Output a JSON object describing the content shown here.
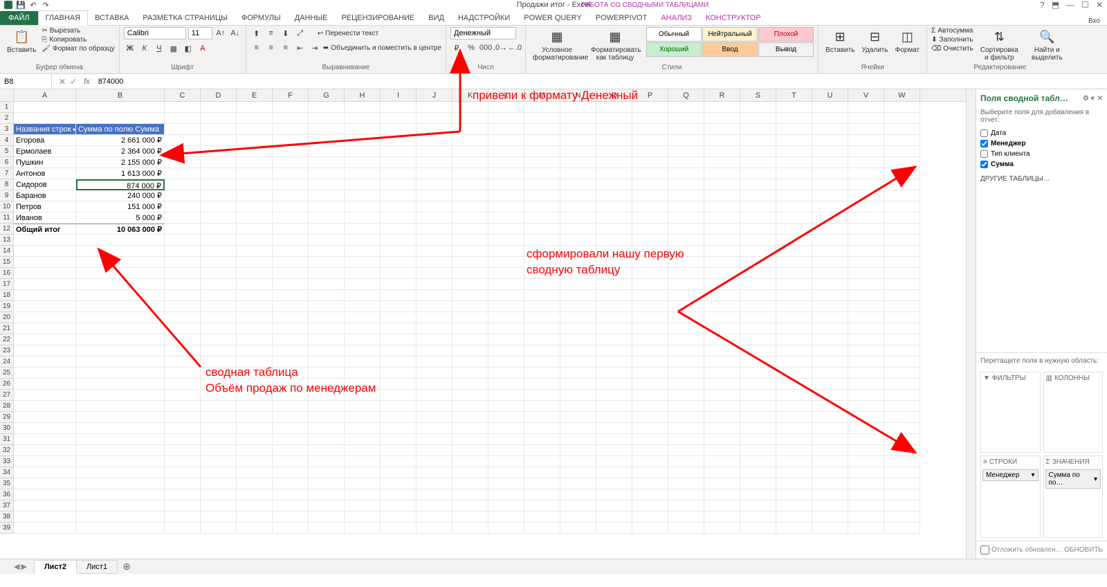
{
  "title": "Продажи итог - Excel",
  "context_title": "РАБОТА СО СВОДНЫМИ ТАБЛИЦАМИ",
  "login_hint": "Вхо",
  "tabs": {
    "file": "ФАЙЛ",
    "home": "ГЛАВНАЯ",
    "insert": "ВСТАВКА",
    "layout": "РАЗМЕТКА СТРАНИЦЫ",
    "formulas": "ФОРМУЛЫ",
    "data": "ДАННЫЕ",
    "review": "РЕЦЕНЗИРОВАНИЕ",
    "view": "ВИД",
    "addins": "НАДСТРОЙКИ",
    "powerquery": "POWER QUERY",
    "powerpivot": "POWERPIVOT",
    "analyze": "АНАЛИЗ",
    "design": "КОНСТРУКТОР"
  },
  "ribbon": {
    "clipboard": {
      "name": "Буфер обмена",
      "paste": "Вставить",
      "cut": "Вырезать",
      "copy": "Копировать",
      "format": "Формат по образцу"
    },
    "font": {
      "name": "Шрифт",
      "font_name": "Calibri",
      "font_size": "11"
    },
    "align": {
      "name": "Выравнивание",
      "wrap": "Перенести текст",
      "merge": "Объединить и поместить в центре"
    },
    "number": {
      "name": "Числ",
      "format": "Денежный"
    },
    "styles": {
      "name": "Стили",
      "cond": "Условное форматирование",
      "table": "Форматировать как таблицу",
      "s1": "Обычный",
      "s2": "Нейтральный",
      "s3": "Плохой",
      "s4": "Хороший",
      "s5": "Ввод",
      "s6": "Вывод"
    },
    "cells": {
      "name": "Ячейки",
      "insert": "Вставить",
      "delete": "Удалить",
      "format": "Формат"
    },
    "edit": {
      "name": "Редактирование",
      "sum": "Автосумма",
      "fill": "Заполнить",
      "clear": "Очистить",
      "sort": "Сортировка и фильтр",
      "find": "Найти и выделить"
    }
  },
  "namebox": "B8",
  "formula": "874000",
  "columns": [
    "A",
    "B",
    "C",
    "D",
    "E",
    "F",
    "G",
    "H",
    "I",
    "J",
    "K",
    "L",
    "M",
    "N",
    "O",
    "P",
    "Q",
    "R",
    "S",
    "T",
    "U",
    "V",
    "W"
  ],
  "pivot": {
    "hdr_a": "Названия строк",
    "hdr_b": "Сумма по полю Сумма",
    "rows": [
      {
        "name": "Егорова",
        "val": "2 661 000 ₽"
      },
      {
        "name": "Ермолаев",
        "val": "2 364 000 ₽"
      },
      {
        "name": "Пушкин",
        "val": "2 155 000 ₽"
      },
      {
        "name": "Антонов",
        "val": "1 613 000 ₽"
      },
      {
        "name": "Сидоров",
        "val": "874 000 ₽"
      },
      {
        "name": "Баранов",
        "val": "240 000 ₽"
      },
      {
        "name": "Петров",
        "val": "151 000 ₽"
      },
      {
        "name": "Иванов",
        "val": "5 000 ₽"
      }
    ],
    "total_label": "Общий итог",
    "total_val": "10 063 000 ₽"
  },
  "fieldpanel": {
    "title": "Поля сводной табл…",
    "sub": "Выберите поля для добавления в отчет:",
    "fields": [
      {
        "label": "Дата",
        "checked": false
      },
      {
        "label": "Менеджер",
        "checked": true
      },
      {
        "label": "Тип клиента",
        "checked": false
      },
      {
        "label": "Сумма",
        "checked": true
      }
    ],
    "other": "ДРУГИЕ ТАБЛИЦЫ…",
    "drag": "Перетащите поля в нужную область:",
    "area_filters": "ФИЛЬТРЫ",
    "area_cols": "КОЛОННЫ",
    "area_rows": "СТРОКИ",
    "area_vals": "ЗНАЧЕНИЯ",
    "row_chip": "Менеджер",
    "val_chip": "Сумма по по…",
    "defer": "Отложить обновлен…",
    "update": "ОБНОВИТЬ"
  },
  "sheets": {
    "active": "Лист2",
    "other": "Лист1"
  },
  "annotations": {
    "a1": "привели к формату Денежный",
    "a2": "сформировали нашу первую\nсводную таблицу",
    "a3": "сводная таблица\nОбъём продаж по менеджерам"
  }
}
